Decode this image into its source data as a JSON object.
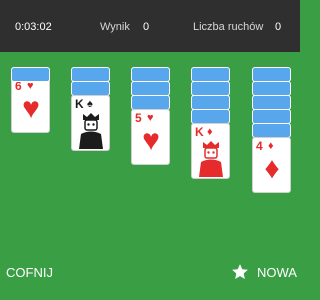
{
  "header": {
    "timer": "0:03:02",
    "score_label": "Wynik",
    "score_value": "0",
    "moves_label": "Liczba ruchów",
    "moves_value": "0"
  },
  "tableau": [
    {
      "face_down": 1,
      "face_up": {
        "rank": "6",
        "suit": "hearts",
        "symbol": "♥"
      }
    },
    {
      "face_down": 2,
      "face_up": {
        "rank": "K",
        "suit": "spades",
        "symbol": "♠"
      }
    },
    {
      "face_down": 3,
      "face_up": {
        "rank": "5",
        "suit": "hearts",
        "symbol": "♥"
      }
    },
    {
      "face_down": 4,
      "face_up": {
        "rank": "K",
        "suit": "diamonds",
        "symbol": "♦"
      }
    },
    {
      "face_down": 5,
      "face_up": {
        "rank": "4",
        "suit": "diamonds",
        "symbol": "♦"
      }
    }
  ],
  "footer": {
    "undo_label": "COFNIJ",
    "new_label": "NOWA"
  },
  "colors": {
    "felt": "#3a9e45",
    "bar": "#2f2f2f",
    "card_back": "#58a7ec",
    "red_suit": "#e52b2b",
    "black_suit": "#1c1c1c"
  },
  "icons": {
    "new_game": "star-icon"
  }
}
